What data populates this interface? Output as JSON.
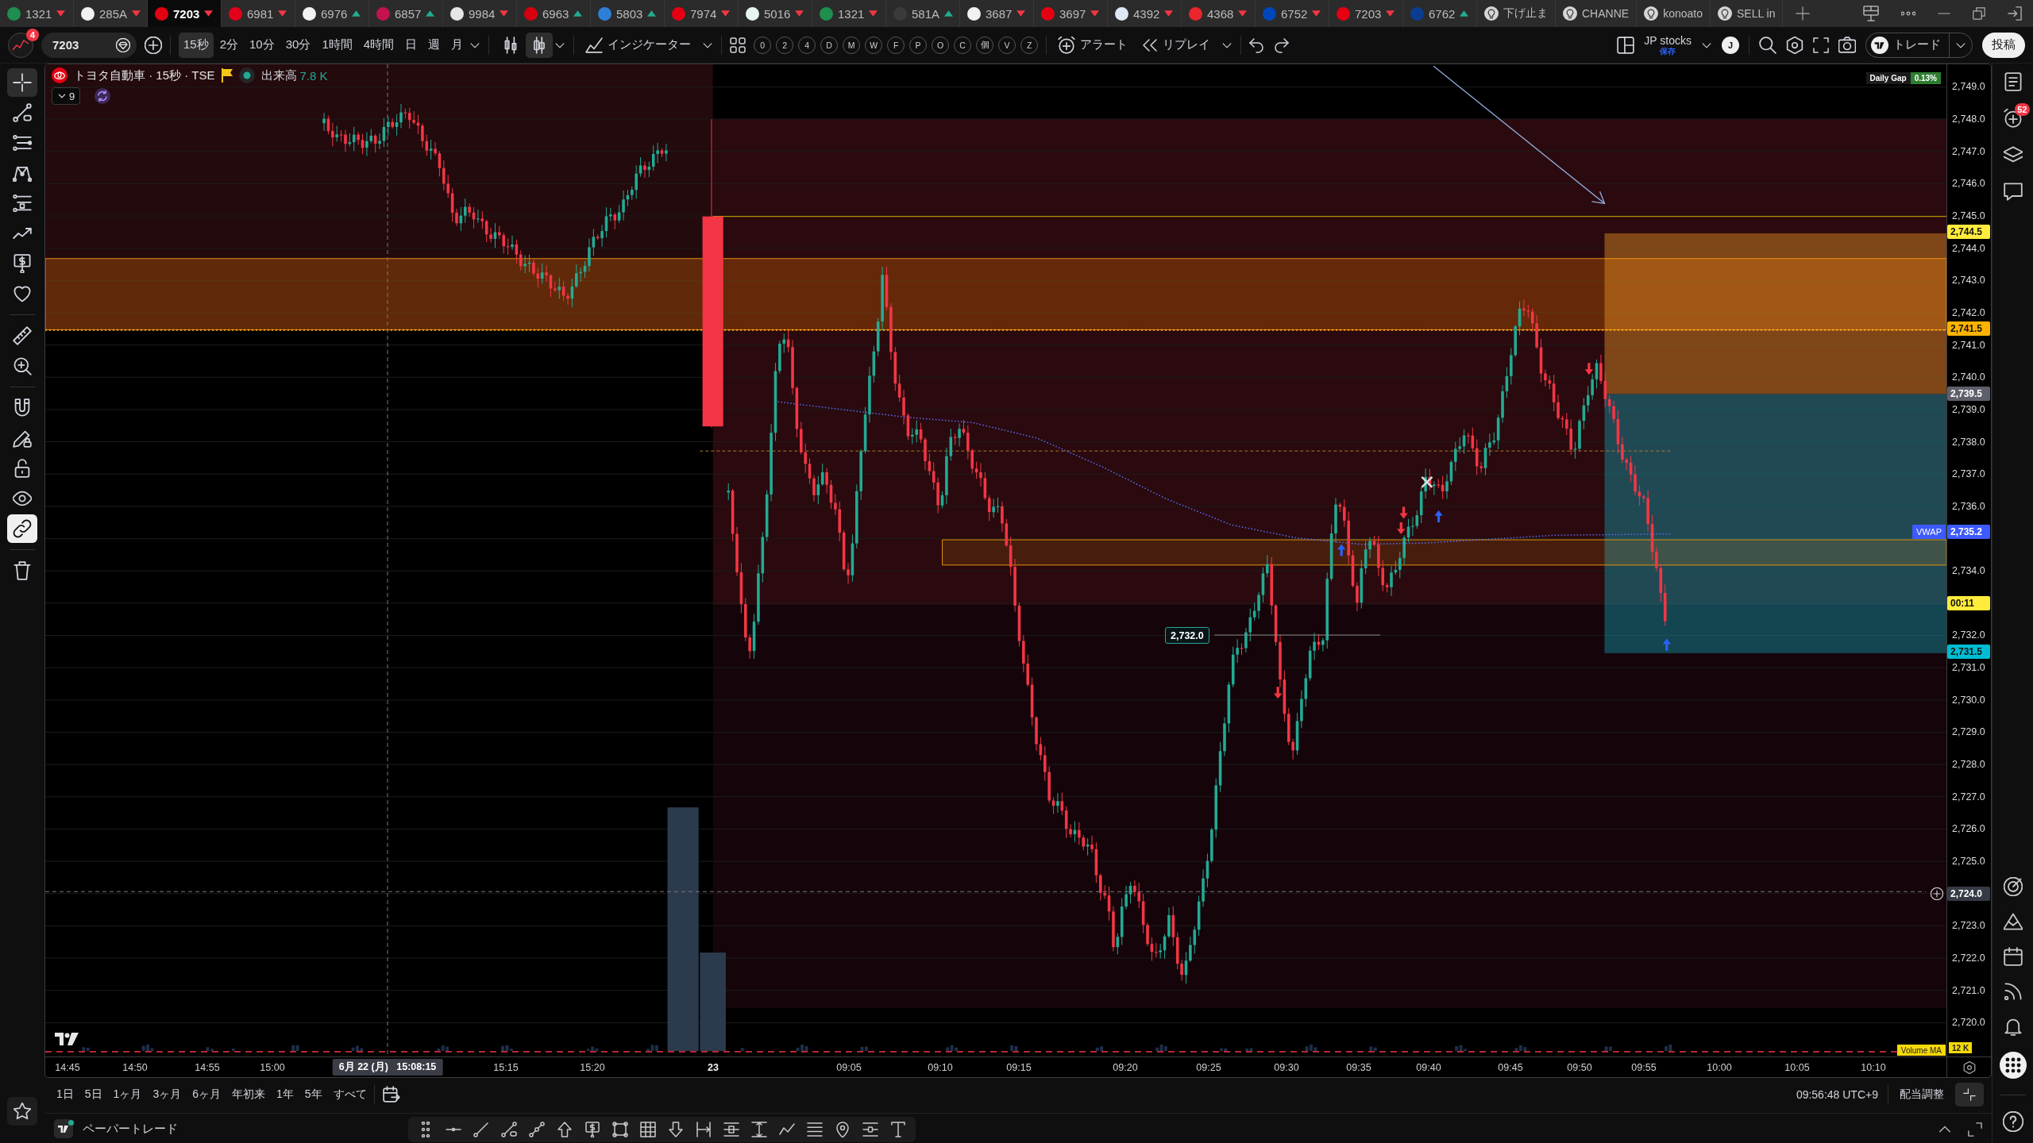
{
  "symbol_tabs": [
    {
      "code": "1321",
      "falling": true,
      "color": "#1e8f4e",
      "selected": false
    },
    {
      "code": "285A",
      "falling": true,
      "color": "#f2f2f2",
      "selected": false
    },
    {
      "code": "7203",
      "falling": true,
      "color": "#e50012",
      "selected": true
    },
    {
      "code": "6981",
      "falling": true,
      "color": "#e3001b",
      "selected": false
    },
    {
      "code": "6976",
      "falling": false,
      "color": "#f2f2f2",
      "selected": false
    },
    {
      "code": "6857",
      "falling": false,
      "color": "#c4124e",
      "selected": false
    },
    {
      "code": "9984",
      "falling": true,
      "color": "#e6e6e6",
      "selected": false
    },
    {
      "code": "6963",
      "falling": false,
      "color": "#d7000f",
      "selected": false
    },
    {
      "code": "5803",
      "falling": false,
      "color": "#2f7fd8",
      "selected": false
    },
    {
      "code": "7974",
      "falling": true,
      "color": "#e60012",
      "selected": false
    },
    {
      "code": "5016",
      "falling": true,
      "color": "#e8f4f0",
      "selected": false
    },
    {
      "code": "1321",
      "falling": true,
      "color": "#1e8f4e",
      "selected": false
    },
    {
      "code": "581A",
      "falling": false,
      "color": "#3a3a3a",
      "selected": false
    },
    {
      "code": "3687",
      "falling": true,
      "color": "#f2f2f2",
      "selected": false
    },
    {
      "code": "3697",
      "falling": true,
      "color": "#e60012",
      "selected": false
    },
    {
      "code": "4392",
      "falling": true,
      "color": "#dfe9f5",
      "selected": false
    },
    {
      "code": "4368",
      "falling": true,
      "color": "#e8262b",
      "selected": false
    },
    {
      "code": "6752",
      "falling": true,
      "color": "#0047bb",
      "selected": false
    },
    {
      "code": "7203",
      "falling": true,
      "color": "#e50012",
      "selected": false
    },
    {
      "code": "6762",
      "falling": false,
      "color": "#0a3d91",
      "selected": false
    }
  ],
  "script_tabs": [
    {
      "label": "下げ止ま",
      "selected": false
    },
    {
      "label": "CHANNE",
      "selected": false
    },
    {
      "label": "konoato",
      "selected": false
    },
    {
      "label": "SELL in",
      "selected": false
    }
  ],
  "toolbar": {
    "notification_count": "4",
    "symbol": "7203",
    "timeframes": [
      {
        "label": "15秒",
        "selected": true
      },
      {
        "label": "2分",
        "selected": false
      },
      {
        "label": "10分",
        "selected": false
      },
      {
        "label": "30分",
        "selected": false
      },
      {
        "label": "1時間",
        "selected": false
      },
      {
        "label": "4時間",
        "selected": false
      },
      {
        "label": "日",
        "selected": false
      },
      {
        "label": "週",
        "selected": false
      },
      {
        "label": "月",
        "selected": false
      }
    ],
    "chart_types": [
      {
        "selected": false
      },
      {
        "selected": true
      }
    ],
    "indicators_label": "インジケーター",
    "shortcuts": [
      "0",
      "2",
      "4",
      "D",
      "M",
      "W",
      "F",
      "P",
      "O",
      "C",
      "個",
      "V",
      "Z"
    ],
    "alert_label": "アラート",
    "replay_label": "リプレイ",
    "layout_name": "JP stocks",
    "layout_status": "保存",
    "user_initial": "J",
    "trade_label": "トレード",
    "publish_label": "投稿"
  },
  "left_toolbar": {
    "tools": [
      {
        "selected": true
      },
      {
        "selected": false
      },
      {
        "selected": false
      },
      {
        "selected": false
      },
      {
        "selected": false
      },
      {
        "selected": false
      },
      {
        "selected": false
      },
      {
        "selected": false
      },
      {
        "selected": false
      },
      {
        "selected": false
      }
    ],
    "toggles": [
      {
        "on": false
      },
      {
        "on": false
      },
      {
        "on": false
      },
      {
        "on": false
      },
      {
        "on": true
      }
    ]
  },
  "chart": {
    "legend": {
      "title": "トヨタ自動車 · 15秒 · TSE",
      "volume_label": "出来高",
      "volume_value": "7.8 K",
      "hidden_count": "9"
    },
    "daily_gap": {
      "label": "Daily Gap",
      "value": "0.13%"
    },
    "price_ticks": [
      "2,749.0",
      "2,748.0",
      "2,747.0",
      "2,746.0",
      "2,745.0",
      "2,744.0",
      "2,743.0",
      "2,742.0",
      "2,741.0",
      "2,740.0",
      "2,739.0",
      "2,738.0",
      "2,737.0",
      "2,736.0",
      "2,734.0",
      "2,732.0",
      "2,731.0",
      "2,730.0",
      "2,729.0",
      "2,728.0",
      "2,727.0",
      "2,726.0",
      "2,725.0",
      "2,723.0",
      "2,722.0",
      "2,721.0",
      "2,720.0"
    ],
    "price_labels": [
      {
        "text": "2,744.5",
        "color": "#ffeb3b",
        "kind": "line"
      },
      {
        "text": "2,741.5",
        "color": "#ffb300",
        "kind": "line"
      },
      {
        "text": "2,739.5",
        "color": "#5d606b",
        "kind": "line"
      },
      {
        "text": "2,735.2",
        "color": "#3d5afe",
        "kind": "vwap",
        "tag": "VWAP"
      },
      {
        "text": "00:11",
        "color": "#ffeb3b",
        "kind": "countdown"
      },
      {
        "text": "2,731.5",
        "color": "#00bcd4",
        "kind": "line"
      },
      {
        "text": "2,724.0",
        "color": "#363a45",
        "kind": "crosshair"
      }
    ],
    "note_label": "2,732.0",
    "volume_ma": {
      "label": "Volume MA",
      "value": "12 K"
    },
    "time_labels": [
      {
        "text": "14:45",
        "kind": "time"
      },
      {
        "text": "14:50",
        "kind": "time"
      },
      {
        "text": "14:55",
        "kind": "time"
      },
      {
        "text": "15:00",
        "kind": "time"
      },
      {
        "text": "15:15",
        "kind": "time"
      },
      {
        "text": "15:20",
        "kind": "time"
      },
      {
        "text": "23",
        "kind": "day"
      },
      {
        "text": "09:05",
        "kind": "time"
      },
      {
        "text": "09:10",
        "kind": "time"
      },
      {
        "text": "09:15",
        "kind": "time"
      },
      {
        "text": "09:20",
        "kind": "time"
      },
      {
        "text": "09:25",
        "kind": "time"
      },
      {
        "text": "09:30",
        "kind": "time"
      },
      {
        "text": "09:35",
        "kind": "time"
      },
      {
        "text": "09:40",
        "kind": "time"
      },
      {
        "text": "09:45",
        "kind": "time"
      },
      {
        "text": "09:50",
        "kind": "time"
      },
      {
        "text": "09:55",
        "kind": "time"
      },
      {
        "text": "10:00",
        "kind": "time"
      },
      {
        "text": "10:05",
        "kind": "time"
      },
      {
        "text": "10:10",
        "kind": "time"
      }
    ],
    "crosshair_time": "6月 22 (月)   15:08:15"
  },
  "range_bar": {
    "ranges": [
      "1日",
      "5日",
      "1ヶ月",
      "3ヶ月",
      "6ヶ月",
      "年初来",
      "1年",
      "5年",
      "すべて"
    ],
    "clock": "09:56:48 UTC+9",
    "adjust_label": "配当調整"
  },
  "bottom_panel": {
    "title": "ペーパートレード"
  },
  "right_sidebar": {
    "alert_count": "52"
  }
}
